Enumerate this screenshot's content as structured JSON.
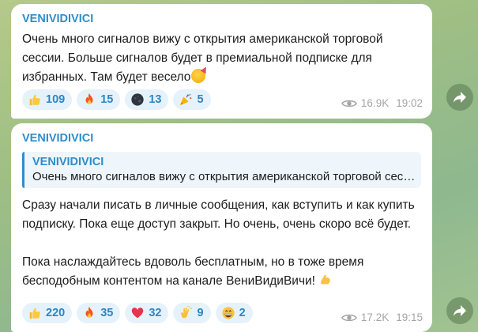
{
  "messages": [
    {
      "author": "VENIVIDIVICI",
      "text": "Очень много сигналов вижу с открытия американской торговой сессии. Больше сигналов будет в премиальной подписке для избранных. Там будет весело",
      "reactions": [
        {
          "icon": "thumbs-up-icon",
          "count": "109"
        },
        {
          "icon": "fire-icon",
          "count": "15"
        },
        {
          "icon": "dark-moon-face-icon",
          "count": "13"
        },
        {
          "icon": "party-popper-icon",
          "count": "5"
        }
      ],
      "views": "16.9K",
      "time": "19:02"
    },
    {
      "author": "VENIVIDIVICI",
      "reply": {
        "author": "VENIVIDIVICI",
        "text": "Очень много сигналов вижу с открытия американской торговой сессии. Больше сигналов будет в премиальной подписке для избранных."
      },
      "text": "Сразу начали писать в личные сообщения, как вступить и как купить  подписку. Пока еще доступ закрыт. Но очень, очень скоро всё будет.\n\nПока наслаждайтесь вдоволь бесплатным, но в тоже время бесподобным контентом на канале ВениВидиВичи!",
      "reactions": [
        {
          "icon": "thumbs-up-icon",
          "count": "220"
        },
        {
          "icon": "fire-icon",
          "count": "35"
        },
        {
          "icon": "heart-icon",
          "count": "32"
        },
        {
          "icon": "clapping-hands-icon",
          "count": "9"
        },
        {
          "icon": "grinning-face-icon",
          "count": "2"
        }
      ],
      "views": "17.2K",
      "time": "19:15"
    }
  ],
  "colors": {
    "accent": "#2f8dc9",
    "reaction_bg": "#e6f2fb",
    "meta": "#a5a5a5"
  }
}
